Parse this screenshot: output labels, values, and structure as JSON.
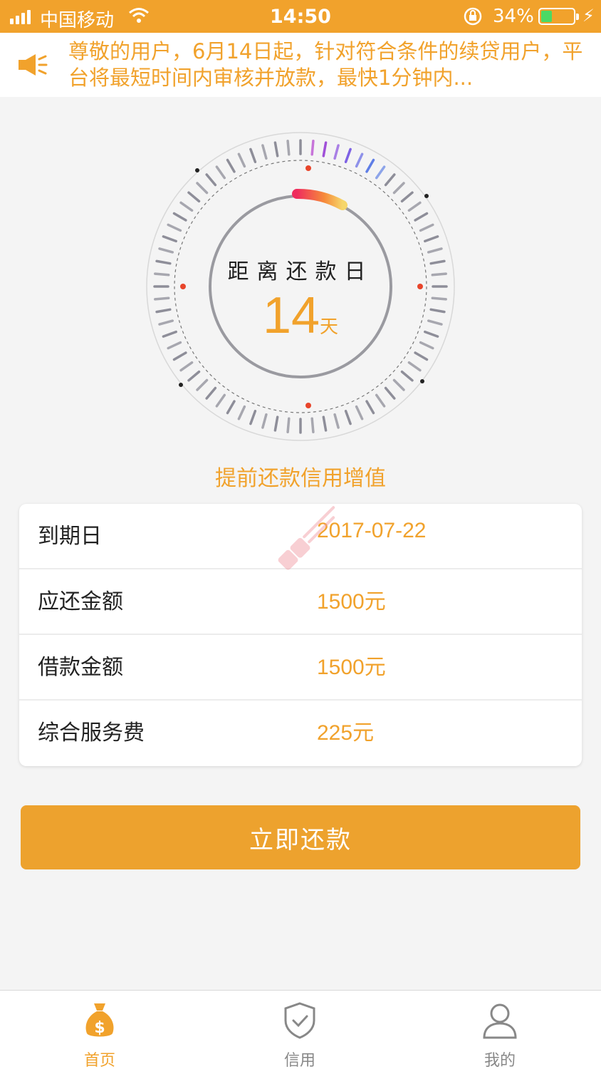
{
  "status_bar": {
    "carrier": "中国移动",
    "time": "14:50",
    "battery_percent": "34%",
    "battery_level": 0.34,
    "battery_color": "#4cd964"
  },
  "notice": {
    "icon": "speaker-icon",
    "text": "尊敬的用户，6月14日起，针对符合条件的续贷用户，平台将最短时间内审核并放款，最快1分钟内..."
  },
  "dial": {
    "label": "距离还款日",
    "days": "14",
    "unit": "天"
  },
  "tagline": "提前还款信用增值",
  "details": [
    {
      "key": "到期日",
      "value": "2017-07-22",
      "unit": ""
    },
    {
      "key": "应还金额",
      "value": "1500",
      "unit": "元"
    },
    {
      "key": "借款金额",
      "value": "1500",
      "unit": "元"
    },
    {
      "key": "综合服务费",
      "value": "225",
      "unit": "元"
    }
  ],
  "pay_button": "立即还款",
  "tabs": [
    {
      "label": "首页",
      "icon": "money-bag-icon",
      "active": true
    },
    {
      "label": "信用",
      "icon": "shield-check-icon",
      "active": false
    },
    {
      "label": "我的",
      "icon": "user-icon",
      "active": false
    }
  ],
  "colors": {
    "accent": "#f1a22c",
    "button": "#eda22e"
  }
}
